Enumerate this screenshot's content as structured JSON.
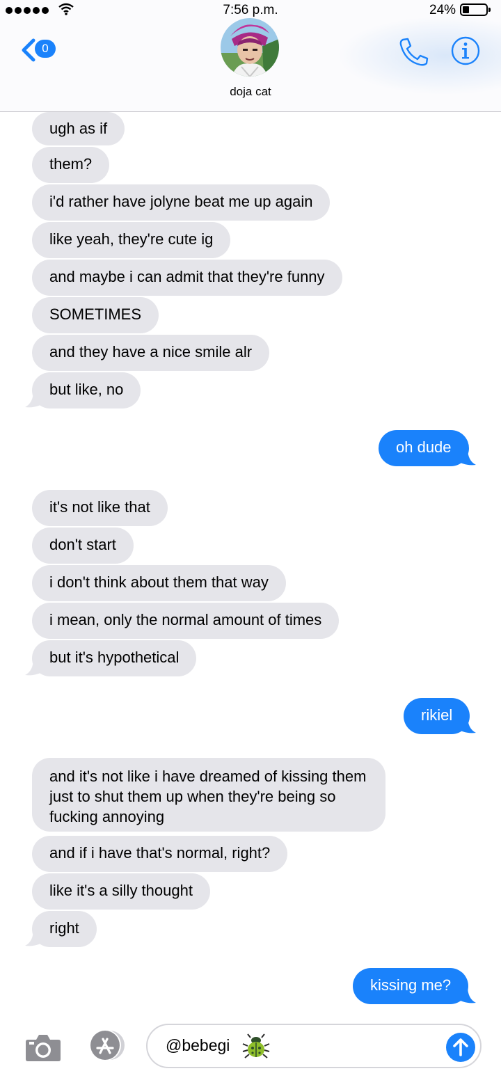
{
  "status_bar": {
    "time": "7:56 p.m.",
    "battery_percent": "24%",
    "battery_level": 0.24
  },
  "header": {
    "back_badge": "0",
    "contact_name": "doja cat"
  },
  "messages": [
    {
      "text": "ugh as if"
    },
    {
      "text": "them?"
    },
    {
      "text": "i'd rather have jolyne beat me up again"
    },
    {
      "text": "like yeah, they're cute ig"
    },
    {
      "text": "and maybe i can admit that they're funny"
    },
    {
      "text": "SOMETIMES"
    },
    {
      "text": "and they have a nice smile alr"
    },
    {
      "text": "but like, no"
    },
    {
      "text": "oh dude"
    },
    {
      "text": "it's not like that"
    },
    {
      "text": "don't start"
    },
    {
      "text": "i don't think about them that way"
    },
    {
      "text": "i mean, only the normal amount of times"
    },
    {
      "text": "but it's hypothetical"
    },
    {
      "text": "rikiel"
    },
    {
      "text": "and it's not like i have dreamed of kissing them just to shut them up when they're being so fucking annoying"
    },
    {
      "text": "and if i have that's normal, right?"
    },
    {
      "text": "like it's a silly thought"
    },
    {
      "text": "right"
    },
    {
      "text": "kissing me?"
    }
  ],
  "composer": {
    "input_value": "@bebegi"
  },
  "colors": {
    "outgoing": "#1a82fb",
    "incoming": "#e5e5ea",
    "accent": "#1a82fb"
  },
  "icons": [
    "back-chevron-icon",
    "phone-icon",
    "info-icon",
    "camera-icon",
    "app-store-icon",
    "beetle-emoji-icon",
    "send-arrow-icon"
  ]
}
